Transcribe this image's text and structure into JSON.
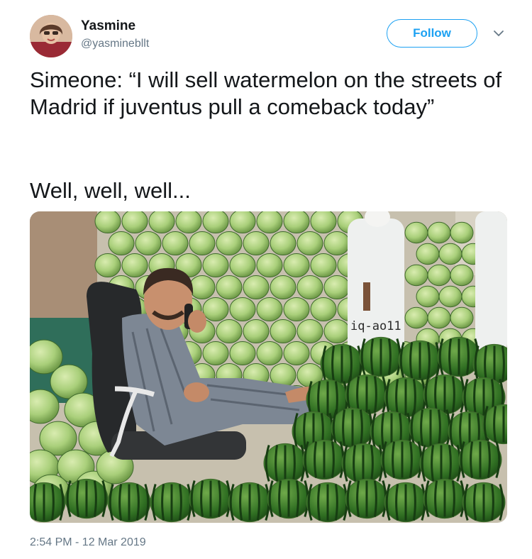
{
  "user": {
    "name": "Yasmine",
    "handle": "@yasminebllt"
  },
  "actions": {
    "follow_label": "Follow"
  },
  "tweet": {
    "text": "Simeone: “I will sell watermelon on the streets of Madrid if juventus pull a comeback today”",
    "text2": "Well, well, well...",
    "media_watermark": "iq-ao11",
    "timestamp": "2:54 PM - 12 Mar 2019"
  },
  "colors": {
    "accent": "#1da1f2",
    "secondary_text": "#657786",
    "primary_text": "#14171a"
  }
}
